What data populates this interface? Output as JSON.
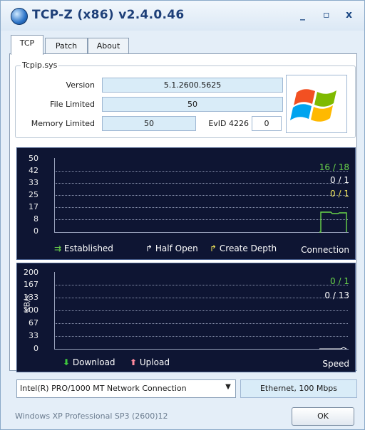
{
  "window": {
    "title": "TCP-Z  (x86)  v2.4.0.46",
    "minimize_glyph": "_",
    "maximize_glyph": "▫",
    "close_glyph": "x"
  },
  "tabs": [
    {
      "label": "TCP"
    },
    {
      "label": "Patch"
    },
    {
      "label": "About"
    }
  ],
  "tcpip": {
    "group_title": "Tcpip.sys",
    "version_label": "Version",
    "version_value": "5.1.2600.5625",
    "file_limited_label": "File Limited",
    "file_limited_value": "50",
    "memory_limited_label": "Memory Limited",
    "memory_limited_value": "50",
    "evid_label": "EvID 4226",
    "evid_value": "0",
    "logo_icon": "windows-flag-icon"
  },
  "connection_graph": {
    "yticks": [
      "50",
      "42",
      "33",
      "25",
      "17",
      "8",
      "0"
    ],
    "stats": [
      {
        "text": "16 / 18",
        "color": "#6ad64a"
      },
      {
        "text": "0 / 1",
        "color": "#ffffff"
      },
      {
        "text": "0 / 1",
        "color": "#f0e45a"
      }
    ],
    "legend": [
      {
        "label": "Established",
        "color": "#6ad64a"
      },
      {
        "label": "Half Open",
        "color": "#ffffff"
      },
      {
        "label": "Create Depth",
        "color": "#f0e45a"
      }
    ],
    "caption": "Connection"
  },
  "speed_graph": {
    "yticks": [
      "200",
      "167",
      "133",
      "100",
      "67",
      "33",
      "0"
    ],
    "unit": "KB/s",
    "stats": [
      {
        "text": "0 / 1",
        "color": "#6ad64a"
      },
      {
        "text": "0 / 13",
        "color": "#ffffff"
      }
    ],
    "legend": [
      {
        "label": "Download",
        "color": "#3ec63e"
      },
      {
        "label": "Upload",
        "color": "#ff8a9e"
      }
    ],
    "caption": "Speed"
  },
  "adapter": {
    "selected": "Intel(R) PRO/1000 MT Network Connection",
    "link": "Ethernet,   100 Mbps"
  },
  "footer": {
    "os_text": "Windows XP Professional SP3 (2600)12",
    "ok_label": "OK"
  }
}
